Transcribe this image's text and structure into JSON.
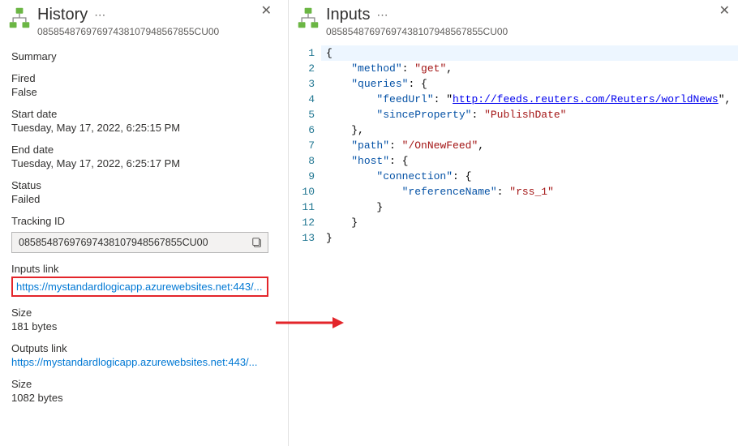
{
  "history": {
    "title": "History",
    "subtitle": "08585487697697438107948567855CU00",
    "summary": {
      "label": "Summary"
    },
    "fired": {
      "label": "Fired",
      "value": "False"
    },
    "startDate": {
      "label": "Start date",
      "value": "Tuesday, May 17, 2022, 6:25:15 PM"
    },
    "endDate": {
      "label": "End date",
      "value": "Tuesday, May 17, 2022, 6:25:17 PM"
    },
    "status": {
      "label": "Status",
      "value": "Failed"
    },
    "trackingId": {
      "label": "Tracking ID",
      "value": "08585487697697438107948567855CU00"
    },
    "inputsLink": {
      "label": "Inputs link",
      "url": "https://mystandardlogicapp.azurewebsites.net:443/..."
    },
    "inputsSize": {
      "label": "Size",
      "value": "181 bytes"
    },
    "outputsLink": {
      "label": "Outputs link",
      "url": "https://mystandardlogicapp.azurewebsites.net:443/..."
    },
    "outputsSize": {
      "label": "Size",
      "value": "1082 bytes"
    }
  },
  "inputs": {
    "title": "Inputs",
    "subtitle": "08585487697697438107948567855CU00",
    "json": {
      "method": "get",
      "queries": {
        "feedUrl": "http://feeds.reuters.com/Reuters/worldNews",
        "sinceProperty": "PublishDate"
      },
      "path": "/OnNewFeed",
      "host": {
        "connection": {
          "referenceName": "rss_1"
        }
      }
    }
  }
}
